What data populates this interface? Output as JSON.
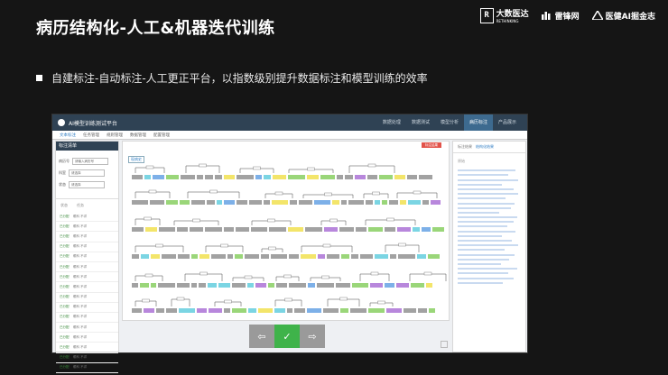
{
  "slide": {
    "title": "病历结构化-人工&机器迭代训练",
    "bullet": "自建标注-自动标注-人工更正平台，以指数级别提升数据标注和模型训练的效率",
    "logos": [
      {
        "mark": "R",
        "name": "大数医达",
        "sub": "RETHINKING"
      },
      {
        "name": "雷锋网"
      },
      {
        "name": "医健AI掘金志"
      }
    ]
  },
  "app": {
    "title": "AI模型训练测试平台",
    "nav": [
      "数据处理",
      "数据测试",
      "模型分析",
      "病历标注",
      "产品展示"
    ],
    "nav_active": "病历标注",
    "subtabs": [
      "文本标注",
      "任务管理",
      "规则管理",
      "数据管理",
      "配置管理"
    ],
    "sidebar": {
      "title": "标注清单",
      "fields": [
        {
          "label": "病历号",
          "value": "请输入病历号"
        },
        {
          "label": "科室",
          "value": "请选择"
        },
        {
          "label": "状态",
          "value": "请选择"
        }
      ],
      "list_headers": [
        "状态",
        "任务"
      ],
      "rows": [
        {
          "status": "已分配",
          "text": "眼科 不详"
        },
        {
          "status": "已分配",
          "text": "眼科 不详"
        },
        {
          "status": "已分配",
          "text": "眼科 不详"
        },
        {
          "status": "已分配",
          "text": "眼科 不详"
        },
        {
          "status": "已分配",
          "text": "眼科 不详"
        },
        {
          "status": "已分配",
          "text": "眼科 不详"
        },
        {
          "status": "已分配",
          "text": "眼科 不详"
        },
        {
          "status": "已分配",
          "text": "眼科 不详"
        },
        {
          "status": "已分配",
          "text": "眼科 不详"
        },
        {
          "status": "已分配",
          "text": "眼科 不详"
        },
        {
          "status": "已分配",
          "text": "眼科 不详"
        },
        {
          "status": "已分配",
          "text": "眼科 不详"
        },
        {
          "status": "已分配",
          "text": "眼科 不详"
        },
        {
          "status": "已分配",
          "text": "眼科 不详"
        },
        {
          "status": "已分配",
          "text": "眼科 不详"
        },
        {
          "status": "已分配",
          "text": "眼科 不详"
        }
      ]
    },
    "main": {
      "tag": "现病史",
      "red_button": "标注结果"
    },
    "right_panel": {
      "tabs": [
        "标注结果",
        "结构化结果"
      ],
      "heading": "原始"
    },
    "controls": {
      "prev": "⇦",
      "confirm": "✓",
      "next": "⇨"
    },
    "colors": {
      "topbar": "#2f4254",
      "confirm": "#3fb34a",
      "highlight_yellow": "#f2e25a",
      "highlight_green": "#8fd16a",
      "highlight_cyan": "#6dd0e0",
      "highlight_purple": "#b07ad8"
    }
  }
}
